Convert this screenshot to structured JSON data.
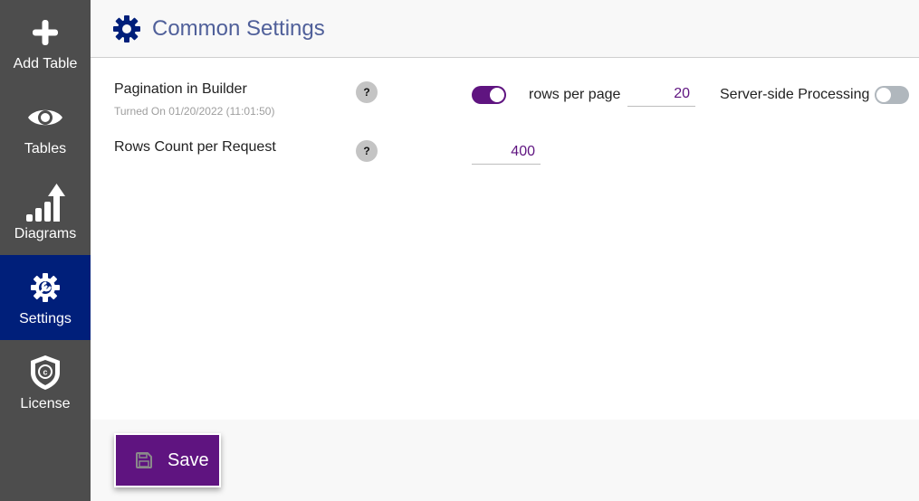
{
  "sidebar": {
    "items": [
      {
        "label": "Add Table",
        "icon": "plus-icon",
        "active": false
      },
      {
        "label": "Tables",
        "icon": "eye-icon",
        "active": false
      },
      {
        "label": "Diagrams",
        "icon": "bar-chart-arrow-icon",
        "active": false
      },
      {
        "label": "Settings",
        "icon": "gear-wrench-icon",
        "active": true
      },
      {
        "label": "License",
        "icon": "shield-copyright-icon",
        "active": false
      }
    ]
  },
  "header": {
    "icon": "gear-icon",
    "title": "Common Settings"
  },
  "settings": {
    "pagination": {
      "label": "Pagination in Builder",
      "sub": "Turned On 01/20/2022 (11:01:50)",
      "help": "?",
      "enabled": true,
      "rows_per_page_label": "rows per page",
      "rows_per_page_value": "20",
      "server_side_label": "Server-side Processing",
      "server_side_enabled": false
    },
    "rows_count": {
      "label": "Rows Count per Request",
      "help": "?",
      "value": "400"
    }
  },
  "footer": {
    "save_label": "Save",
    "save_icon": "floppy-disk-icon"
  },
  "colors": {
    "sidebar_bg": "#4d4d4d",
    "sidebar_active": "#001f7a",
    "accent": "#5f1480",
    "title": "#50609a"
  }
}
